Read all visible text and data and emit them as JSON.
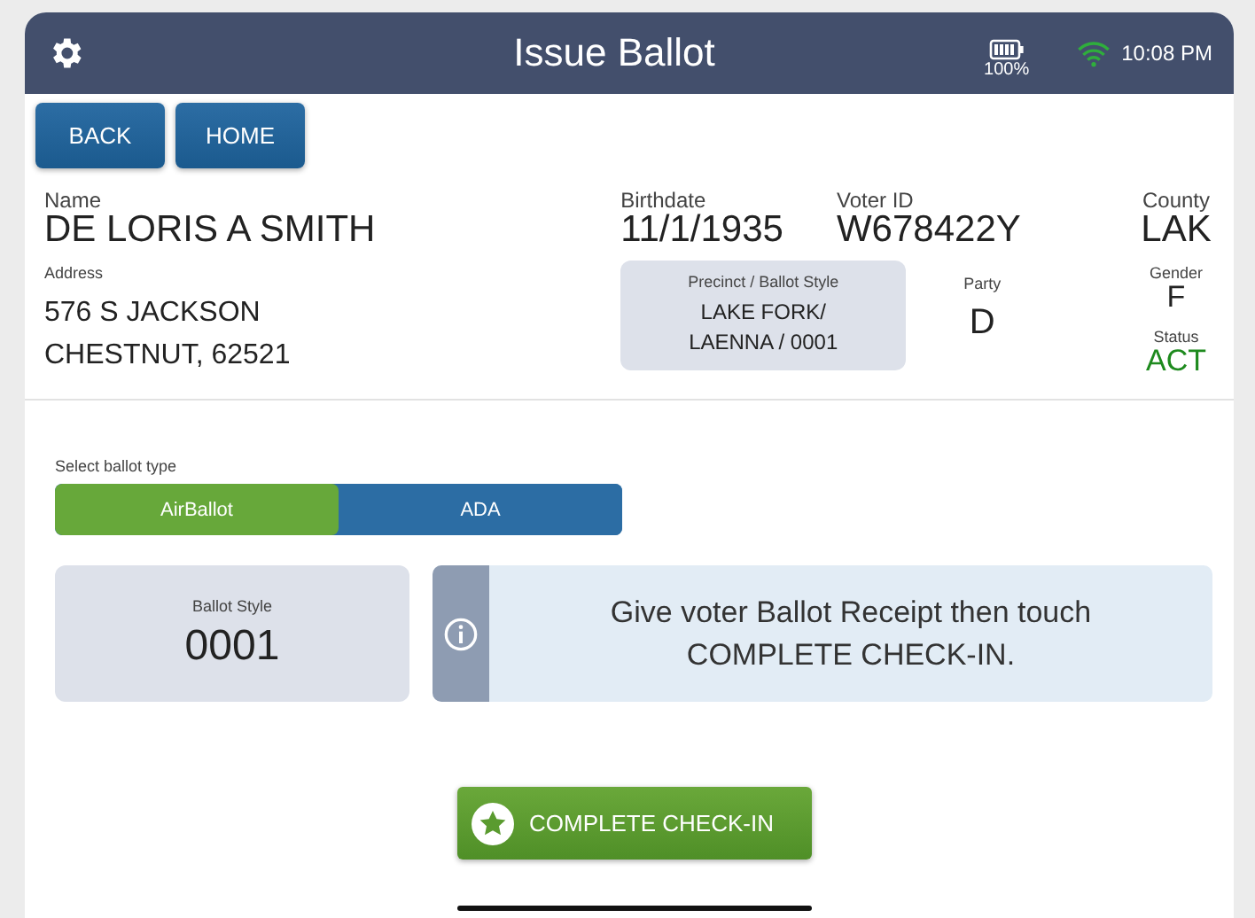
{
  "header": {
    "title": "Issue Ballot",
    "battery": "100%",
    "time": "10:08 PM"
  },
  "nav_buttons": [
    "BACK",
    "HOME"
  ],
  "voter": {
    "name_label": "Name",
    "name": "DE LORIS A SMITH",
    "address_label": "Address",
    "address_lines": [
      "576 S JACKSON",
      "CHESTNUT, 62521"
    ],
    "birthdate_label": "Birthdate",
    "birthdate": "11/1/1935",
    "voter_id_label": "Voter ID",
    "voter_id": "W678422Y",
    "county_label": "County",
    "county": "LAK",
    "precinct_label": "Precinct / Ballot Style",
    "precinct_lines": [
      "LAKE FORK/",
      "LAENNA / 0001"
    ],
    "party_label": "Party",
    "party": "D",
    "gender_label": "Gender",
    "gender": "F",
    "status_label": "Status",
    "status": "ACT"
  },
  "ballot_type": {
    "label": "Select ballot type",
    "options": [
      {
        "label": "AirBallot",
        "selected": true
      },
      {
        "label": "ADA",
        "selected": false
      }
    ]
  },
  "ballot_style": {
    "label": "Ballot Style",
    "value": "0001"
  },
  "info": {
    "lines": [
      "Give voter Ballot Receipt then touch",
      "COMPLETE CHECK-IN."
    ]
  },
  "complete_button": "COMPLETE CHECK-IN"
}
